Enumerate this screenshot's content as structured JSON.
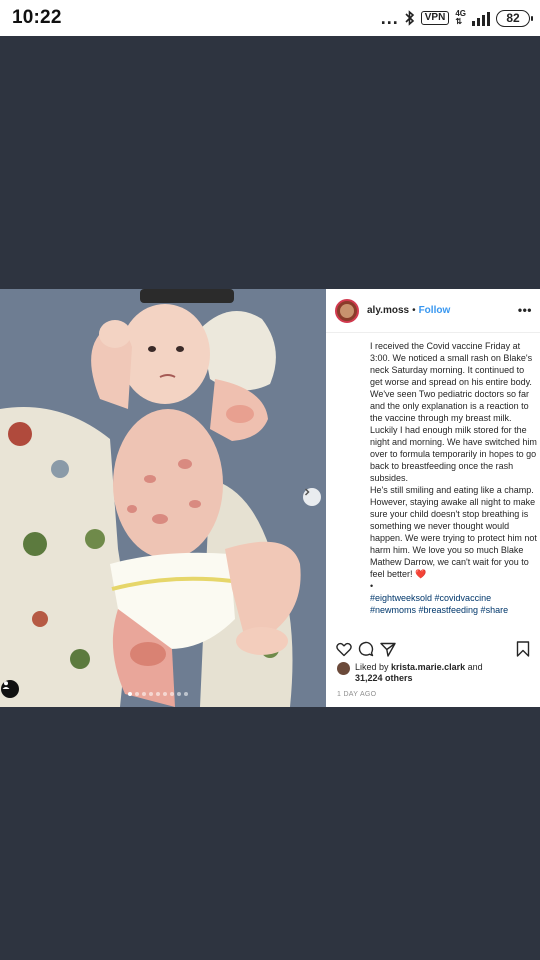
{
  "status_bar": {
    "time": "10:22",
    "dots": "...",
    "vpn": "VPN",
    "network": "4G",
    "battery": "82"
  },
  "post": {
    "username": "aly.moss",
    "separator": "•",
    "follow_label": "Follow",
    "caption_paragraphs": [
      "I received the Covid vaccine Friday at 3:00. We noticed a small rash on Blake's neck Saturday morning. It continued to get worse and spread on his entire body. We've seen Two pediatric doctors so far and the only explanation is a reaction to the vaccine through my breast milk.",
      "Luckily I had enough milk stored for the night and morning. We have switched him over to formula temporarily in hopes to go back to breastfeeding once the rash subsides.",
      "He's still smiling and eating like a champ.",
      "However, staying awake all night to make sure your child doesn't stop breathing is something we never thought would happen. We were trying to protect him not harm him. We love you so much Blake Mathew Darrow, we can't wait for you to feel better!"
    ],
    "caption_emoji": "❤️",
    "bullet": "•",
    "hashtags": "#eightweeksold #covidvaccine",
    "hashtags_cut": "#newmoms #breastfeeding #share",
    "liked_by_prefix": "Liked by",
    "liked_by_user": "krista.marie.clark",
    "liked_by_and": "and",
    "likes_count": "31,224 others",
    "time_ago": "1 DAY AGO",
    "carousel_count": 9,
    "carousel_active": 0
  },
  "colors": {
    "background": "#2e3440",
    "link": "#3897f0",
    "hashtag": "#00376b"
  }
}
